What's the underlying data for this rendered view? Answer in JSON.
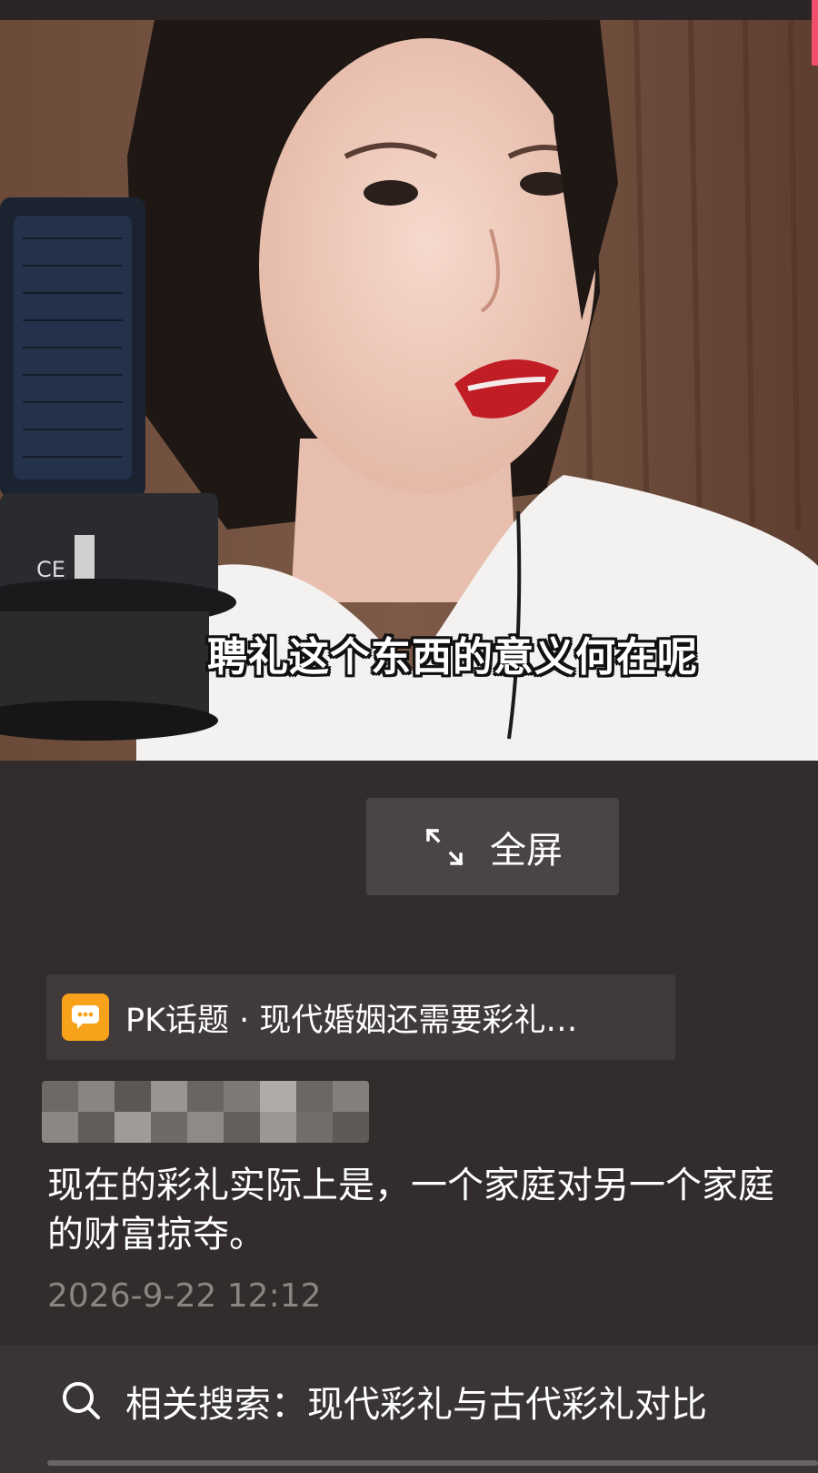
{
  "video": {
    "subtitle": "聘礼这个东西的意义何在呢"
  },
  "fullscreen_button": {
    "label": "全屏",
    "icon": "expand-arrows-icon"
  },
  "pk_topic": {
    "icon": "chat-bubble-icon",
    "icon_color": "#f8a21b",
    "text": "PK话题 · 现代婚姻还需要彩礼…"
  },
  "comment": {
    "text": "现在的彩礼实际上是，一个家庭对另一个家庭的财富掠夺。",
    "timestamp": "2026-9-22 12:12"
  },
  "related_search": {
    "icon": "search-icon",
    "text": "相关搜索：现代彩礼与古代彩礼对比"
  }
}
